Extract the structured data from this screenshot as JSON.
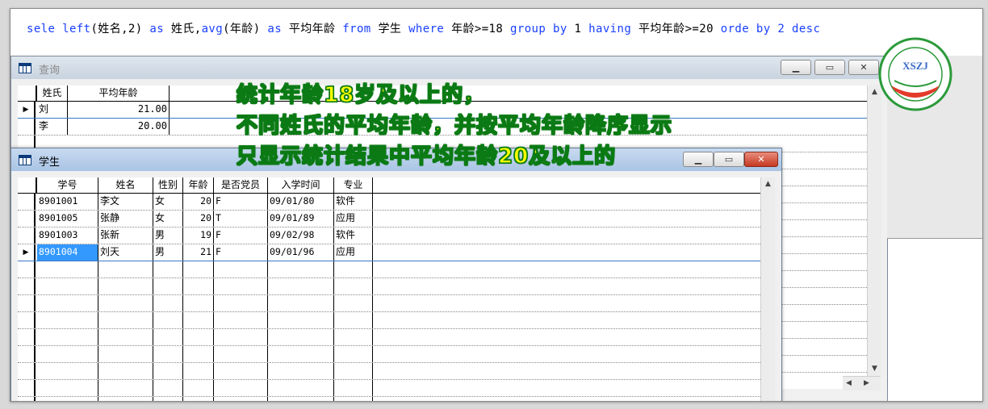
{
  "command": {
    "parts": [
      {
        "t": "sele left",
        "k": true
      },
      {
        "t": "(姓名,2) ",
        "k": false
      },
      {
        "t": "as",
        "k": true
      },
      {
        "t": " 姓氏,",
        "k": false
      },
      {
        "t": "avg",
        "k": true
      },
      {
        "t": "(年龄) ",
        "k": false
      },
      {
        "t": "as",
        "k": true
      },
      {
        "t": " 平均年龄 ",
        "k": false
      },
      {
        "t": "from",
        "k": true
      },
      {
        "t": " 学生 ",
        "k": false
      },
      {
        "t": "where",
        "k": true
      },
      {
        "t": " 年龄>=18 ",
        "k": false
      },
      {
        "t": "group by",
        "k": true
      },
      {
        "t": " 1 ",
        "k": false
      },
      {
        "t": "having",
        "k": true
      },
      {
        "t": " 平均年龄>=20 ",
        "k": false
      },
      {
        "t": "orde by 2 desc",
        "k": true
      }
    ]
  },
  "query_window": {
    "title": "查询",
    "columns": [
      "姓氏",
      "平均年龄"
    ],
    "rows": [
      {
        "surname": "刘",
        "avg": "21.00"
      },
      {
        "surname": "李",
        "avg": "20.00"
      }
    ]
  },
  "student_window": {
    "title": "学生",
    "columns": [
      "学号",
      "姓名",
      "性别",
      "年龄",
      "是否党员",
      "入学时间",
      "专业"
    ],
    "rows": [
      [
        "8901001",
        "李文",
        "女",
        "20",
        "F",
        "09/01/80",
        "软件"
      ],
      [
        "8901005",
        "张静",
        "女",
        "20",
        "T",
        "09/01/89",
        "应用"
      ],
      [
        "8901003",
        "张新",
        "男",
        "19",
        "F",
        "09/02/98",
        "软件"
      ],
      [
        "8901004",
        "刘天",
        "男",
        "21",
        "F",
        "09/01/96",
        "应用"
      ]
    ],
    "current_row": 3
  },
  "annotation": {
    "line1": "统计年龄18岁及以上的，",
    "line2": "不同姓氏的平均年龄，并按平均年龄降序显示",
    "line3": "只显示统计结果中平均年龄20及以上的"
  },
  "logo": {
    "text": "XSZJ",
    "icon": "school-seal-icon"
  },
  "icons": {
    "minimize": "minimize-icon",
    "maximize": "maximize-icon",
    "close": "close-icon",
    "row_pointer": "row-pointer-icon",
    "grid_window": "grid-window-icon"
  },
  "colors": {
    "keyword": "#1a40ff",
    "annotation_fill": "#ffff00",
    "annotation_stroke": "#0b7a14",
    "selected_cell": "#3399ff",
    "close_button": "#c63a22"
  }
}
